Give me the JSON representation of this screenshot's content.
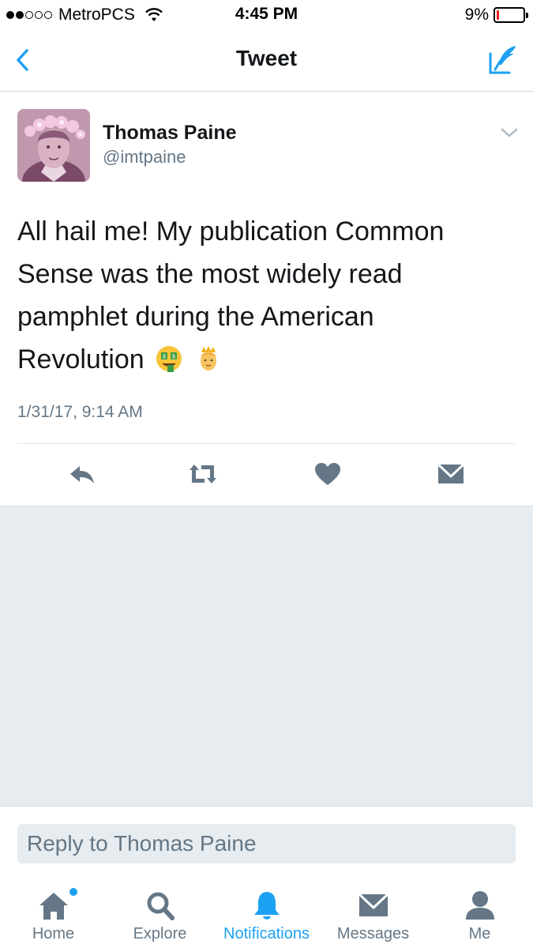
{
  "status_bar": {
    "carrier": "MetroPCS",
    "time": "4:45 PM",
    "battery_percent": "9%",
    "battery_level": 0.09,
    "signal_bars": 2,
    "signal_total": 5
  },
  "nav": {
    "title": "Tweet",
    "back_icon": "chevron-left-icon",
    "compose_icon": "compose-icon",
    "accent_color": "#1da1f2"
  },
  "tweet": {
    "author_name": "Thomas Paine",
    "author_handle": "@imtpaine",
    "text": "All hail me! My publication Common Sense was the most widely read pamphlet during the American Revolution",
    "emojis": [
      "money-mouth-face-emoji",
      "prince-emoji"
    ],
    "timestamp": "1/31/17, 9:14 AM",
    "actions": [
      "reply-icon",
      "retweet-icon",
      "like-icon",
      "direct-message-icon"
    ]
  },
  "reply": {
    "placeholder": "Reply to Thomas Paine"
  },
  "tab_bar": {
    "tabs": [
      {
        "label": "Home",
        "icon": "home-icon",
        "has_badge": true
      },
      {
        "label": "Explore",
        "icon": "search-icon"
      },
      {
        "label": "Notifications",
        "icon": "bell-icon",
        "active": true
      },
      {
        "label": "Messages",
        "icon": "envelope-icon"
      },
      {
        "label": "Me",
        "icon": "person-icon"
      }
    ]
  }
}
